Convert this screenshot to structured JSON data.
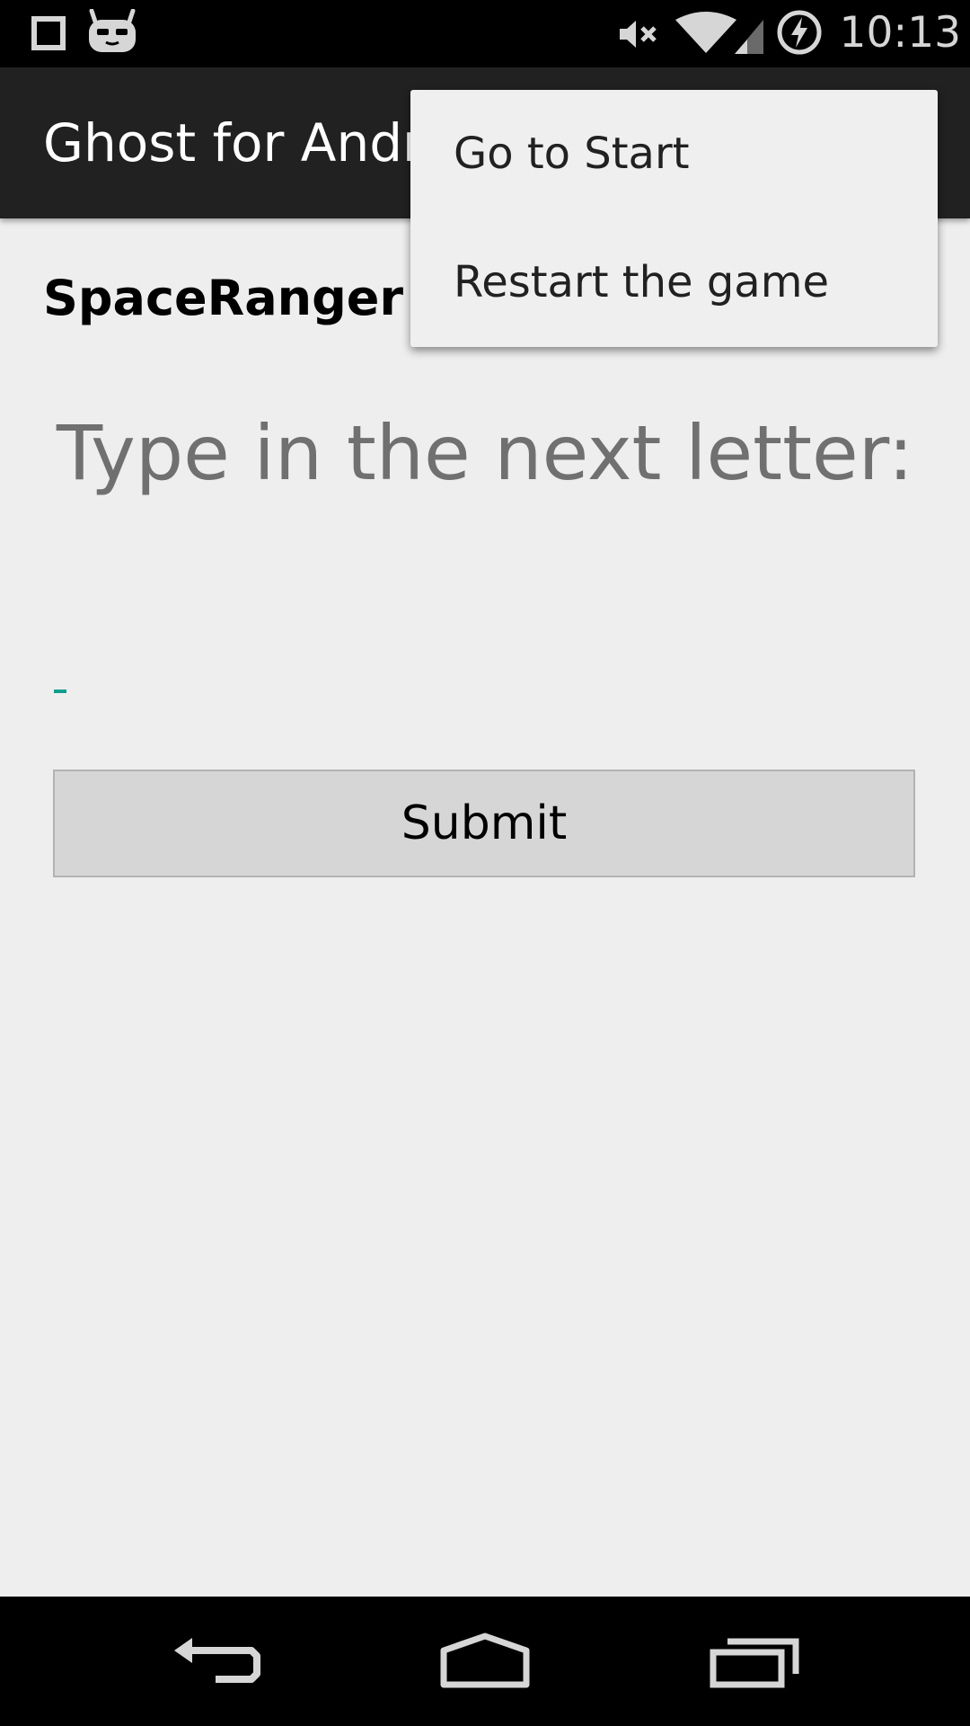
{
  "status_bar": {
    "time": "10:13",
    "icons": [
      "notification-square-icon",
      "cyanogenmod-icon",
      "volume-mute-icon",
      "wifi-icon",
      "signal-icon",
      "battery-charging-icon"
    ]
  },
  "action_bar": {
    "title": "Ghost for Android"
  },
  "content": {
    "player_name": "SpaceRanger",
    "prompt": "Type in the next letter:",
    "letter_input": {
      "value": "",
      "placeholder": ""
    },
    "submit_label": "Submit"
  },
  "overflow_menu": {
    "items": [
      {
        "label": "Go to Start"
      },
      {
        "label": "Restart the game"
      }
    ]
  },
  "nav_bar": {
    "buttons": [
      "back-icon",
      "home-icon",
      "recents-icon"
    ]
  },
  "colors": {
    "status_bar": "#000000",
    "action_bar": "#212121",
    "background": "#eeeeee",
    "menu_background": "#efefef",
    "prompt_text": "#707070",
    "accent": "#0f9d8e",
    "button": "#d6d6d6"
  }
}
